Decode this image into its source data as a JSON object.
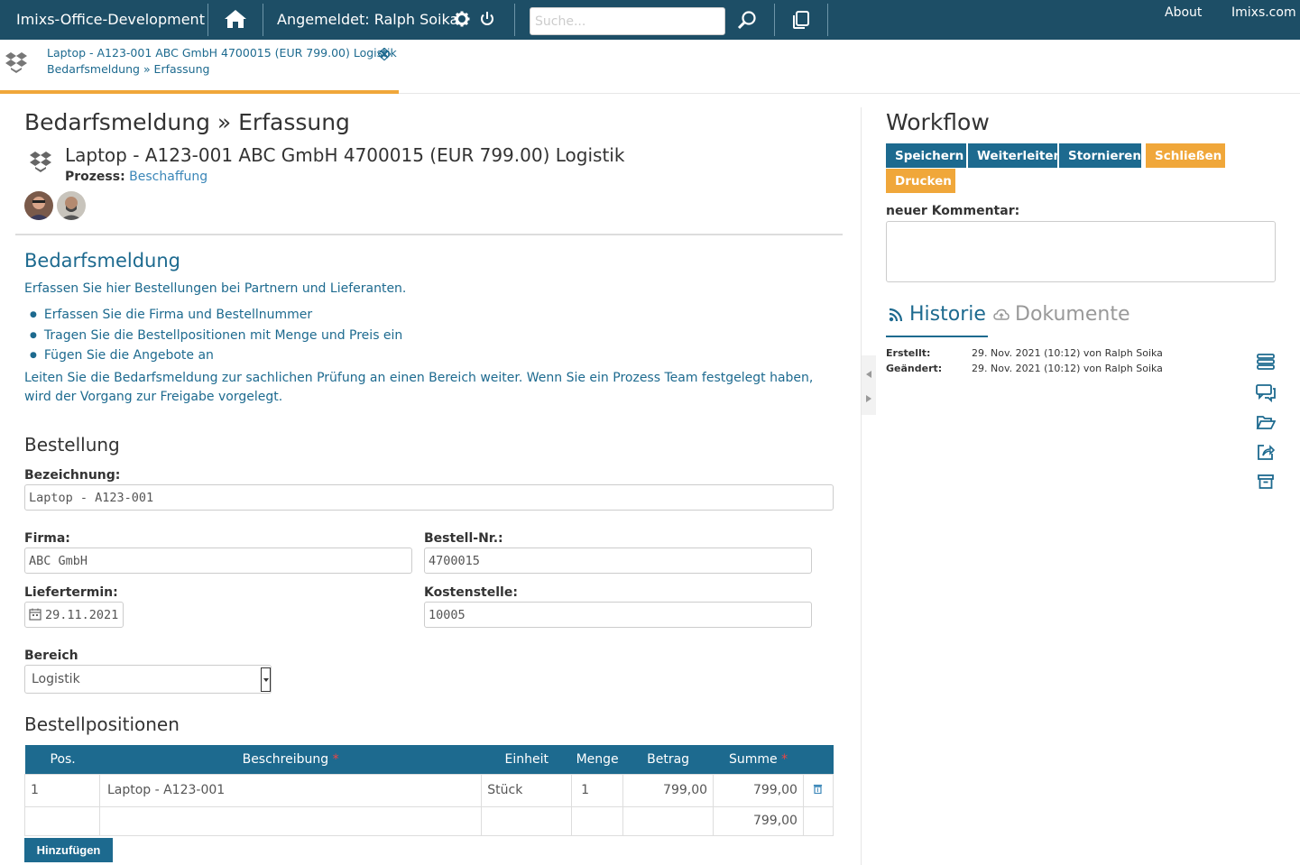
{
  "topbar": {
    "brand": "Imixs-Office-Development",
    "login": "Angemeldet: Ralph Soika",
    "search_placeholder": "Suche...",
    "about": "About",
    "imixs": "Imixs.com"
  },
  "crumb": {
    "line1": "Laptop - A123-001 ABC GmbH 4700015 (EUR 799.00) Logistik",
    "line2": "Bedarfsmeldung » Erfassung"
  },
  "main": {
    "heading": "Bedarfsmeldung » Erfassung",
    "doc_title": "Laptop - A123-001 ABC GmbH 4700015 (EUR 799.00) Logistik",
    "prozess_label": "Prozess:",
    "prozess_link": "Beschaffung",
    "section_title": "Bedarfsmeldung",
    "intro": "Erfassen Sie hier Bestellungen bei Partnern und Lieferanten.",
    "bullets": [
      "Erfassen Sie die Firma und Bestellnummer",
      "Tragen Sie die Bestellpositionen mit Menge und Preis ein",
      "Fügen Sie die Angebote an"
    ],
    "outro": "Leiten Sie die Bedarfsmeldung zur sachlichen Prüfung an einen Bereich weiter. Wenn Sie ein Prozess Team festgelegt haben, wird der Vorgang zur Freigabe vorgelegt."
  },
  "bestellung": {
    "title": "Bestellung",
    "bezeichnung_label": "Bezeichnung:",
    "bezeichnung_value": "Laptop - A123-001",
    "firma_label": "Firma:",
    "firma_value": "ABC GmbH",
    "bestellnr_label": "Bestell-Nr.:",
    "bestellnr_value": "4700015",
    "liefertermin_label": "Liefertermin:",
    "liefertermin_value": "29.11.2021",
    "kostenstelle_label": "Kostenstelle:",
    "kostenstelle_value": "10005",
    "bereich_label": "Bereich",
    "bereich_value": "Logistik"
  },
  "positionen": {
    "title": "Bestellpositionen",
    "headers": [
      "Pos.",
      "Beschreibung",
      "Einheit",
      "Menge",
      "Betrag",
      "Summe"
    ],
    "required_mark": "*",
    "rows": [
      {
        "pos": "1",
        "beschreibung": "Laptop - A123-001",
        "einheit": "Stück",
        "menge": "1",
        "betrag": "799,00",
        "summe": "799,00"
      }
    ],
    "total": "799,00",
    "add_label": "Hinzufügen"
  },
  "workflow": {
    "title": "Workflow",
    "buttons": [
      "Speichern",
      "Weiterleiten",
      "Stornieren",
      "Schließen",
      "Drucken"
    ],
    "comment_label": "neuer Kommentar:",
    "tab_history": "Historie",
    "tab_documents": "Dokumente",
    "created_label": "Erstellt:",
    "created_value": "29. Nov. 2021 (10:12) von Ralph Soika",
    "changed_label": "Geändert:",
    "changed_value": "29. Nov. 2021 (10:12) von Ralph Soika"
  },
  "colors": {
    "topbar": "#1d4e66",
    "primary": "#1d6a8f",
    "accent": "#f0a73a"
  }
}
